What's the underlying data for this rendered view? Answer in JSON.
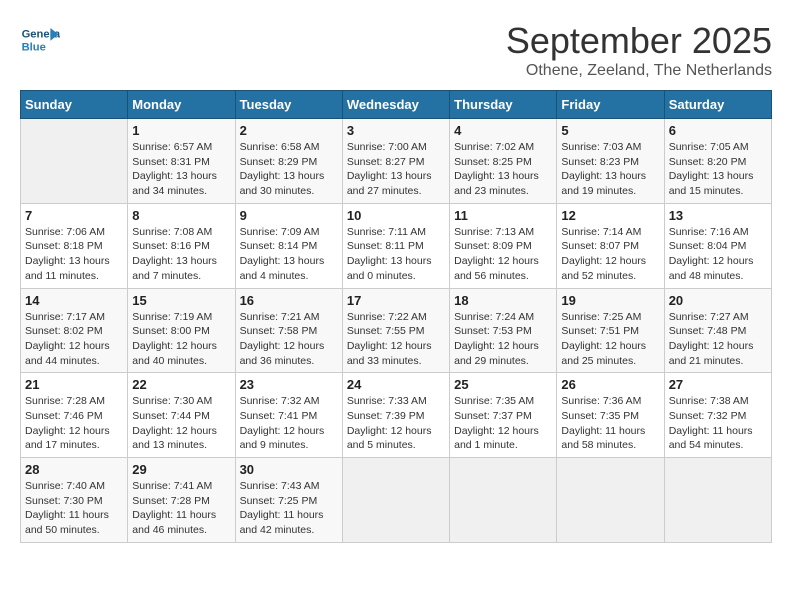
{
  "header": {
    "logo_text_general": "General",
    "logo_text_blue": "Blue",
    "month": "September 2025",
    "location": "Othene, Zeeland, The Netherlands"
  },
  "days_of_week": [
    "Sunday",
    "Monday",
    "Tuesday",
    "Wednesday",
    "Thursday",
    "Friday",
    "Saturday"
  ],
  "weeks": [
    [
      {
        "day": "",
        "info": ""
      },
      {
        "day": "1",
        "info": "Sunrise: 6:57 AM\nSunset: 8:31 PM\nDaylight: 13 hours\nand 34 minutes."
      },
      {
        "day": "2",
        "info": "Sunrise: 6:58 AM\nSunset: 8:29 PM\nDaylight: 13 hours\nand 30 minutes."
      },
      {
        "day": "3",
        "info": "Sunrise: 7:00 AM\nSunset: 8:27 PM\nDaylight: 13 hours\nand 27 minutes."
      },
      {
        "day": "4",
        "info": "Sunrise: 7:02 AM\nSunset: 8:25 PM\nDaylight: 13 hours\nand 23 minutes."
      },
      {
        "day": "5",
        "info": "Sunrise: 7:03 AM\nSunset: 8:23 PM\nDaylight: 13 hours\nand 19 minutes."
      },
      {
        "day": "6",
        "info": "Sunrise: 7:05 AM\nSunset: 8:20 PM\nDaylight: 13 hours\nand 15 minutes."
      }
    ],
    [
      {
        "day": "7",
        "info": "Sunrise: 7:06 AM\nSunset: 8:18 PM\nDaylight: 13 hours\nand 11 minutes."
      },
      {
        "day": "8",
        "info": "Sunrise: 7:08 AM\nSunset: 8:16 PM\nDaylight: 13 hours\nand 7 minutes."
      },
      {
        "day": "9",
        "info": "Sunrise: 7:09 AM\nSunset: 8:14 PM\nDaylight: 13 hours\nand 4 minutes."
      },
      {
        "day": "10",
        "info": "Sunrise: 7:11 AM\nSunset: 8:11 PM\nDaylight: 13 hours\nand 0 minutes."
      },
      {
        "day": "11",
        "info": "Sunrise: 7:13 AM\nSunset: 8:09 PM\nDaylight: 12 hours\nand 56 minutes."
      },
      {
        "day": "12",
        "info": "Sunrise: 7:14 AM\nSunset: 8:07 PM\nDaylight: 12 hours\nand 52 minutes."
      },
      {
        "day": "13",
        "info": "Sunrise: 7:16 AM\nSunset: 8:04 PM\nDaylight: 12 hours\nand 48 minutes."
      }
    ],
    [
      {
        "day": "14",
        "info": "Sunrise: 7:17 AM\nSunset: 8:02 PM\nDaylight: 12 hours\nand 44 minutes."
      },
      {
        "day": "15",
        "info": "Sunrise: 7:19 AM\nSunset: 8:00 PM\nDaylight: 12 hours\nand 40 minutes."
      },
      {
        "day": "16",
        "info": "Sunrise: 7:21 AM\nSunset: 7:58 PM\nDaylight: 12 hours\nand 36 minutes."
      },
      {
        "day": "17",
        "info": "Sunrise: 7:22 AM\nSunset: 7:55 PM\nDaylight: 12 hours\nand 33 minutes."
      },
      {
        "day": "18",
        "info": "Sunrise: 7:24 AM\nSunset: 7:53 PM\nDaylight: 12 hours\nand 29 minutes."
      },
      {
        "day": "19",
        "info": "Sunrise: 7:25 AM\nSunset: 7:51 PM\nDaylight: 12 hours\nand 25 minutes."
      },
      {
        "day": "20",
        "info": "Sunrise: 7:27 AM\nSunset: 7:48 PM\nDaylight: 12 hours\nand 21 minutes."
      }
    ],
    [
      {
        "day": "21",
        "info": "Sunrise: 7:28 AM\nSunset: 7:46 PM\nDaylight: 12 hours\nand 17 minutes."
      },
      {
        "day": "22",
        "info": "Sunrise: 7:30 AM\nSunset: 7:44 PM\nDaylight: 12 hours\nand 13 minutes."
      },
      {
        "day": "23",
        "info": "Sunrise: 7:32 AM\nSunset: 7:41 PM\nDaylight: 12 hours\nand 9 minutes."
      },
      {
        "day": "24",
        "info": "Sunrise: 7:33 AM\nSunset: 7:39 PM\nDaylight: 12 hours\nand 5 minutes."
      },
      {
        "day": "25",
        "info": "Sunrise: 7:35 AM\nSunset: 7:37 PM\nDaylight: 12 hours\nand 1 minute."
      },
      {
        "day": "26",
        "info": "Sunrise: 7:36 AM\nSunset: 7:35 PM\nDaylight: 11 hours\nand 58 minutes."
      },
      {
        "day": "27",
        "info": "Sunrise: 7:38 AM\nSunset: 7:32 PM\nDaylight: 11 hours\nand 54 minutes."
      }
    ],
    [
      {
        "day": "28",
        "info": "Sunrise: 7:40 AM\nSunset: 7:30 PM\nDaylight: 11 hours\nand 50 minutes."
      },
      {
        "day": "29",
        "info": "Sunrise: 7:41 AM\nSunset: 7:28 PM\nDaylight: 11 hours\nand 46 minutes."
      },
      {
        "day": "30",
        "info": "Sunrise: 7:43 AM\nSunset: 7:25 PM\nDaylight: 11 hours\nand 42 minutes."
      },
      {
        "day": "",
        "info": ""
      },
      {
        "day": "",
        "info": ""
      },
      {
        "day": "",
        "info": ""
      },
      {
        "day": "",
        "info": ""
      }
    ]
  ]
}
